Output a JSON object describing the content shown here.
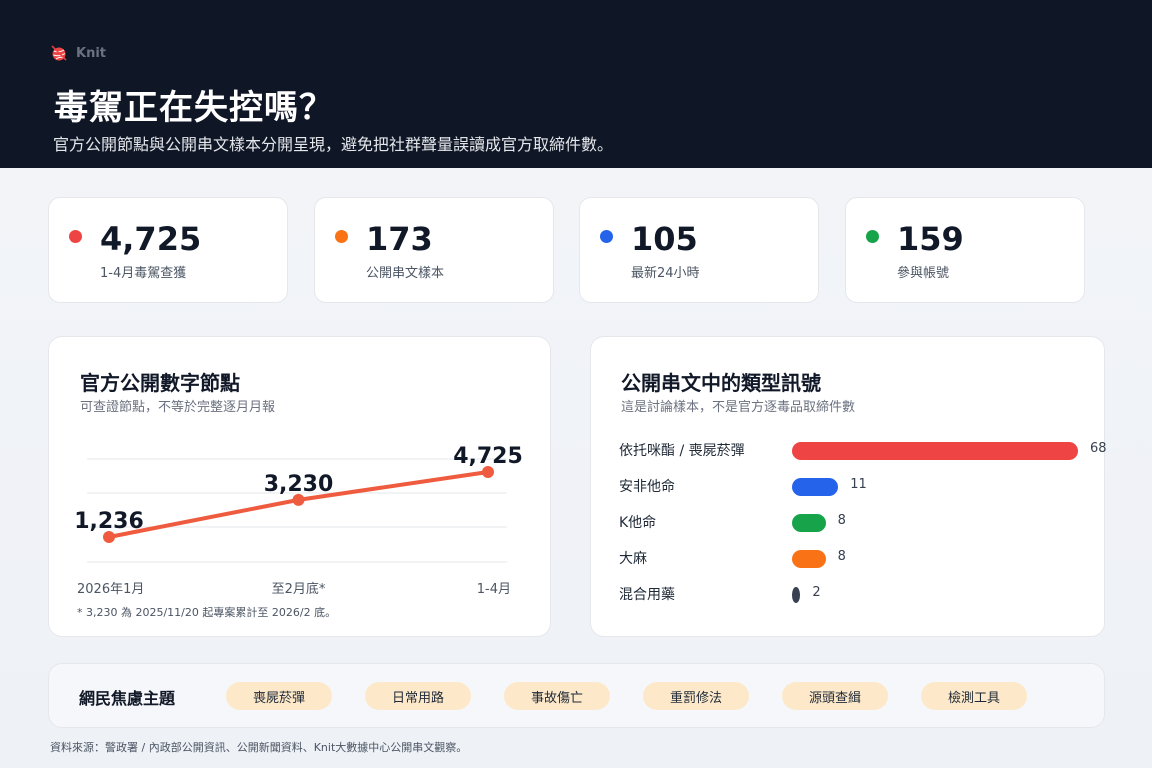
{
  "header": {
    "brand": "Knit",
    "title": "毒駕正在失控嗎？",
    "subtitle": "官方公開節點與公開串文樣本分開呈現，避免把社群聲量誤讀成官方取締件數。"
  },
  "kpis": [
    {
      "value": "4,725",
      "label": "1-4月毒駕查獲",
      "color": "#ef4444"
    },
    {
      "value": "173",
      "label": "公開串文樣本",
      "color": "#f97316"
    },
    {
      "value": "105",
      "label": "最新24小時",
      "color": "#2563eb"
    },
    {
      "value": "159",
      "label": "參與帳號",
      "color": "#16a34a"
    }
  ],
  "line_panel": {
    "title": "官方公開數字節點",
    "subtitle": "可查證節點，不等於完整逐月月報",
    "footnote": "* 3,230 為 2025/11/20 起專案累計至 2026/2 底。"
  },
  "bar_panel": {
    "title": "公開串文中的類型訊號",
    "subtitle": "這是討論樣本，不是官方逐毒品取締件數"
  },
  "chart_data": [
    {
      "type": "line",
      "categories": [
        "2026年1月",
        "至2月底*",
        "1-4月"
      ],
      "values": [
        1236,
        3230,
        4725
      ],
      "data_labels": [
        "1,236",
        "3,230",
        "4,725"
      ],
      "color": "#ef5b3f",
      "grid": true
    },
    {
      "type": "bar",
      "orientation": "horizontal",
      "categories": [
        "依托咪酯 / 喪屍菸彈",
        "安非他命",
        "K他命",
        "大麻",
        "混合用藥"
      ],
      "values": [
        68,
        11,
        8,
        8,
        2
      ],
      "colors": [
        "#ef4444",
        "#2563eb",
        "#16a34a",
        "#f97316",
        "#374151"
      ]
    }
  ],
  "topics": {
    "title": "網民焦慮主題",
    "chips": [
      "喪屍菸彈",
      "日常用路",
      "事故傷亡",
      "重罰修法",
      "源頭查緝",
      "檢測工具"
    ]
  },
  "source": "資料來源：警政署 / 內政部公開資訊、公開新聞資料、Knit大數據中心公開串文觀察。"
}
